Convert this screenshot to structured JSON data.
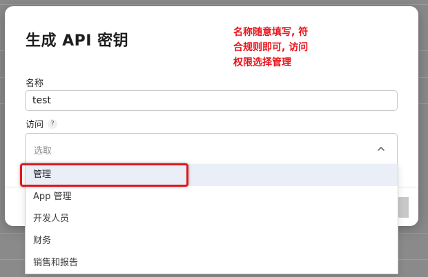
{
  "dialog": {
    "title": "生成 API 密钥",
    "name_label": "名称",
    "name_value": "test",
    "access_label": "访问",
    "help_icon": "?",
    "access_placeholder": "选取"
  },
  "dropdown": {
    "options": [
      "管理",
      "App 管理",
      "开发人员",
      "财务",
      "销售和报告"
    ],
    "selected_index": 0
  },
  "annotation": {
    "lines": [
      "名称随意填写, 符",
      "合规则即可, 访问",
      "权限选择管理"
    ],
    "color": "#e8141c"
  },
  "colors": {
    "highlight": "#e0161d",
    "selected_row": "#e9eef7"
  }
}
